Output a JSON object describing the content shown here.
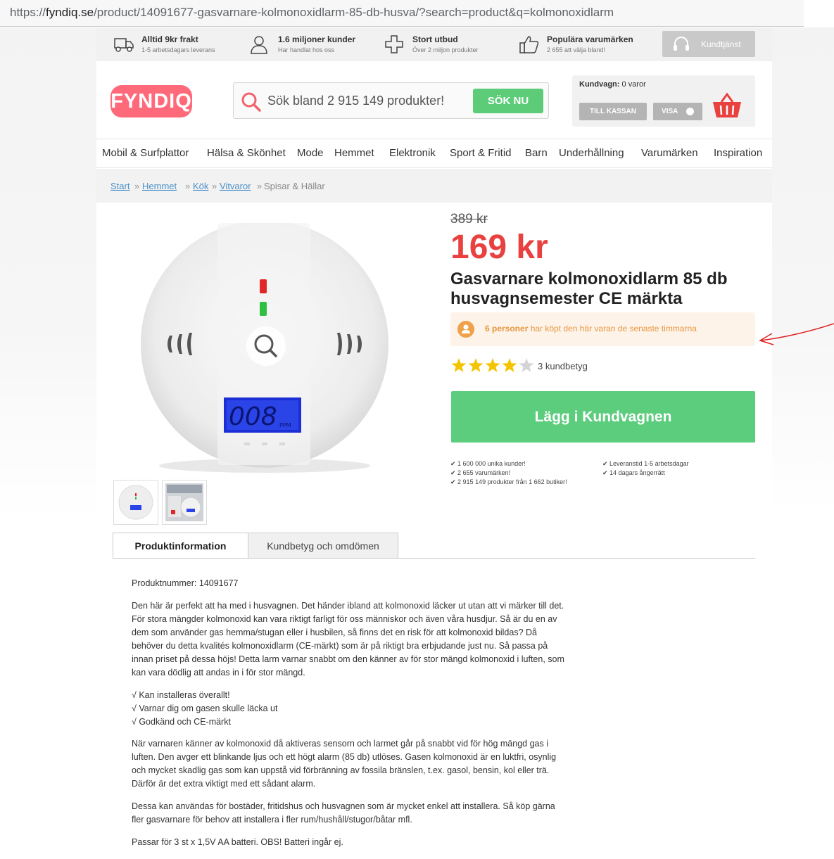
{
  "browser": {
    "url_prefix": "https://",
    "url_host": "fyndiq.se",
    "url_path": "/product/14091677-gasvarnare-kolmonoxidlarm-85-db-husva/?search=product&q=kolmonoxidlarm"
  },
  "usp": [
    {
      "title": "Alltid 9kr frakt",
      "sub": "1-5 arbetsdagars leverans",
      "icon": "truck-icon"
    },
    {
      "title": "1.6 miljoner kunder",
      "sub": "Har handlat hos oss",
      "icon": "user-icon"
    },
    {
      "title": "Stort utbud",
      "sub": "Över 2 miljon produkter",
      "icon": "plus-icon"
    },
    {
      "title": "Populära varumärken",
      "sub": "2 655 att välja bland!",
      "icon": "thumbs-up-icon"
    }
  ],
  "customer_service": "Kundtjänst",
  "logo": "FYNDIQ",
  "search": {
    "placeholder": "Sök bland 2 915 149 produkter!",
    "button": "SÖK NU"
  },
  "cart": {
    "label": "Kundvagn:",
    "count": "0 varor",
    "checkout": "TILL KASSAN",
    "show": "VISA"
  },
  "nav": [
    "Mobil & Surfplattor",
    "Hälsa & Skönhet",
    "Mode",
    "Hemmet",
    "Elektronik",
    "Sport & Fritid",
    "Barn",
    "Underhållning",
    "Varumärken",
    "Inspiration"
  ],
  "breadcrumb": {
    "links": [
      "Start",
      "Hemmet",
      "Kök",
      "Vitvaror"
    ],
    "separator": "»",
    "current": "Spisar & Hällar"
  },
  "product": {
    "old_price": "389 kr",
    "price": "169 kr",
    "title": "Gasvarnare kolmonoxidlarm 85 db husvagnsemester CE märkta",
    "display_reading": "008",
    "display_unit": "PPM",
    "social_count": "6 personer",
    "social_text": " har köpt den här varan de senaste timmarna",
    "rating": 4,
    "rating_max": 5,
    "rating_count": "3 kundbetyg",
    "add_to_cart": "Lägg i Kundvagnen"
  },
  "perks_left": [
    "1 600 000 unika kunder!",
    "2 655 varumärken!",
    "2 915 149 produkter från 1 662 butiker!"
  ],
  "perks_right": [
    "Leveranstid 1-5 arbetsdagar",
    "14 dagars ångerrätt"
  ],
  "tabs": [
    "Produktinformation",
    "Kundbetyg och omdömen"
  ],
  "description": {
    "product_number": "Produktnummer: 14091677",
    "p1": "Den här är perfekt att ha med i husvagnen. Det händer ibland att kolmonoxid läcker ut utan att vi märker till det. För stora mängder kolmonoxid kan vara riktigt farligt för oss människor och även våra husdjur. Så är du en av dem som använder gas hemma/stugan eller i husbilen, så finns det en risk för att kolmonoxid bildas? Då behöver du detta kvalités kolmonoxidlarm (CE-märkt) som är på riktigt bra erbjudande just nu. Så passa på innan priset på dessa höjs! Detta larm varnar snabbt om den känner av för stor mängd kolmonoxid i luften, som kan vara dödlig att andas in i för stor mängd.",
    "bullets": [
      "√ Kan installeras överallt!",
      "√ Varnar dig om gasen skulle läcka ut",
      "√ Godkänd och CE-märkt"
    ],
    "p2": "När varnaren känner av kolmonoxid då aktiveras sensorn och larmet går på snabbt vid för hög mängd gas i luften. Den avger ett blinkande ljus och ett högt alarm (85 db) utlöses. Gasen kolmonoxid är en luktfri, osynlig och mycket skadlig gas som kan uppstå vid förbränning av fossila bränslen, t.ex. gasol, bensin, kol eller trä. Därför är det extra viktigt med ett sådant alarm.",
    "p3": "Dessa kan användas för bostäder, fritidshus och husvagnen som är mycket enkel att installera. Så köp gärna fler gasvarnare för behov att installera i fler rum/hushåll/stugor/båtar mfl.",
    "p4": "Passar för 3 st x 1,5V AA batteri. OBS! Batteri ingår ej."
  },
  "colors": {
    "brand": "#ff6a7b",
    "price": "#e8413f",
    "cta": "#5ccc7d",
    "link": "#4a8fc7",
    "social": "#e8963e",
    "annotation": "#e02020"
  }
}
